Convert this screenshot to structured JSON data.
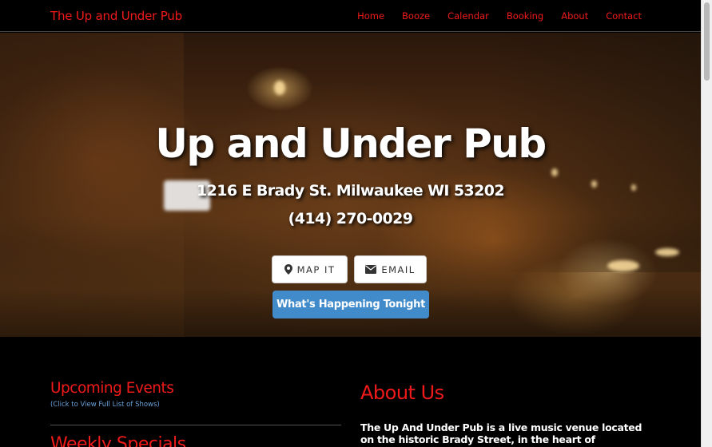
{
  "navbar": {
    "brand": "The Up and Under Pub",
    "items": [
      "Home",
      "Booze",
      "Calendar",
      "Booking",
      "About",
      "Contact"
    ]
  },
  "hero": {
    "title": "Up and Under Pub",
    "address": "1216 E Brady St. Milwaukee WI 53202",
    "phone": "(414) 270-0029",
    "map_button": "MAP IT",
    "email_button": "EMAIL",
    "happening_button": "What's Happening Tonight"
  },
  "left": {
    "upcoming_title": "Upcoming Events",
    "upcoming_link": "(Click to View Full List of Shows)",
    "weekly_title": "Weekly Specials"
  },
  "right": {
    "about_title": "About Us",
    "about_text": "The Up And Under Pub is a live music venue located on the historic Brady Street, in the heart of Milwaukee's"
  },
  "colors": {
    "accent": "#f01a1a",
    "button_blue": "#428bca",
    "link_blue": "#6aa0d8",
    "background": "#000000"
  }
}
